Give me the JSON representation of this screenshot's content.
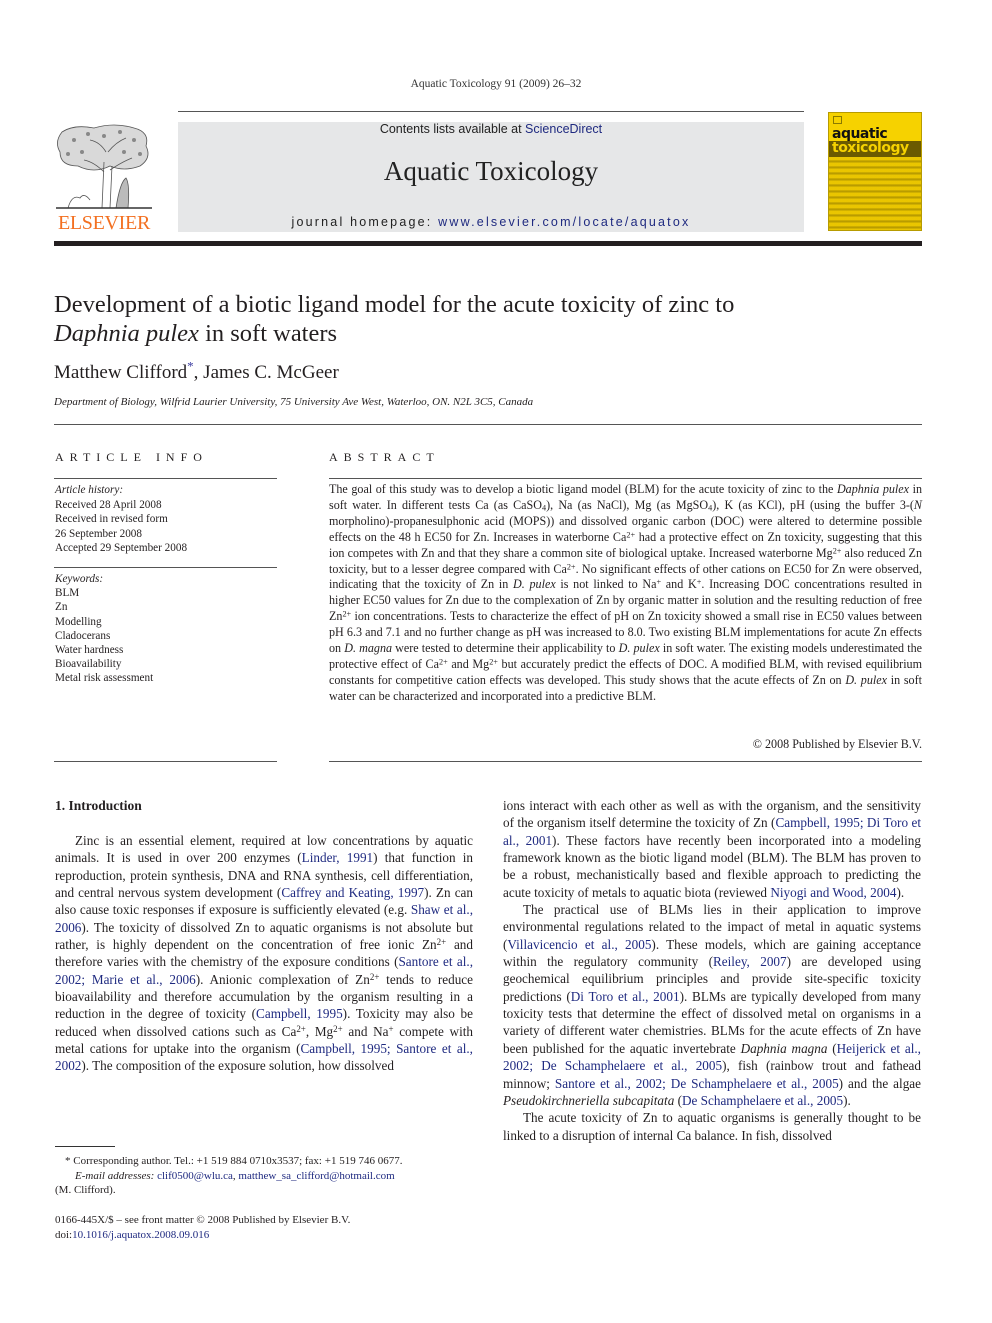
{
  "running_head": "Aquatic Toxicology 91 (2009) 26–32",
  "masthead": {
    "publisher_logo_text": "ELSEVIER",
    "contents_prefix": "Contents lists available at ",
    "contents_link": "ScienceDirect",
    "journal_title": "Aquatic Toxicology",
    "homepage_prefix": "journal homepage: ",
    "homepage_link": "www.elsevier.com/locate/aquatox",
    "cover_line1": "aquatic",
    "cover_line2": "toxicology",
    "colors": {
      "elsevier_orange": "#f37021",
      "banner_gray": "#e6e7e8",
      "cover_yellow": "#f6d200",
      "link_blue": "#1f2a80"
    }
  },
  "article": {
    "title_part1": "Development of a biotic ligand model for the acute toxicity of zinc to ",
    "title_italic": "Daphnia pulex",
    "title_part2": " in soft waters",
    "author1": "Matthew Clifford",
    "author1_mark": "*",
    "author_sep": ", ",
    "author2": "James C. McGeer",
    "affiliation": "Department of Biology, Wilfrid Laurier University, 75 University Ave West, Waterloo, ON. N2L 3C5, Canada"
  },
  "article_info": {
    "heading": "ARTICLE INFO",
    "history_label": "Article history:",
    "history": [
      "Received 28 April 2008",
      "Received in revised form",
      "26 September 2008",
      "Accepted 29 September 2008"
    ],
    "keywords_label": "Keywords:",
    "keywords": [
      "BLM",
      "Zn",
      "Modelling",
      "Cladocerans",
      "Water hardness",
      "Bioavailability",
      "Metal risk assessment"
    ]
  },
  "abstract": {
    "heading": "ABSTRACT",
    "s1": "The goal of this study was to develop a biotic ligand model (BLM) for the acute toxicity of zinc to the ",
    "s1_it": "Daphnia pulex",
    "s2": " in soft water. In different tests Ca (as CaSO",
    "s2_sub": "4",
    "s3": "), Na (as NaCl), Mg (as MgSO",
    "s3_sub": "4",
    "s4": "), K (as KCl), pH (using the buffer 3-(",
    "s4_it": "N",
    "s5": " morpholino)-propanesulphonic acid (MOPS)) and dissolved organic carbon (DOC) were altered to determine possible effects on the 48 h EC50 for Zn. Increases in waterborne Ca",
    "sup_2plus": "2+",
    "s6": " had a protective effect on Zn toxicity, suggesting that this ion competes with Zn and that they share a common site of biological uptake. Increased waterborne Mg",
    "s7": " also reduced Zn toxicity, but to a lesser degree compared with Ca",
    "s8": ". No significant effects of other cations on EC50 for Zn were observed, indicating that the toxicity of Zn in ",
    "s8_it": "D. pulex",
    "s9": " is not linked to Na",
    "sup_plus": "+",
    "s10": " and K",
    "s11": ". Increasing DOC concentrations resulted in higher EC50 values for Zn due to the complexation of Zn by organic matter in solution and the resulting reduction of free Zn",
    "s12": " ion concentrations. Tests to characterize the effect of pH on Zn toxicity showed a small rise in EC50 values between pH 6.3 and 7.1 and no further change as pH was increased to 8.0. Two existing BLM implementations for acute Zn effects on ",
    "s12_it": "D. magna",
    "s13": " were tested to determine their applicability to ",
    "s13_it": "D. pulex",
    "s14": " in soft water. The existing models underestimated the protective effect of Ca",
    "s15": " and Mg",
    "s16": " but accurately predict the effects of DOC. A modified BLM, with revised equilibrium constants for competitive cation effects was developed. This study shows that the acute effects of Zn on ",
    "s16_it": "D. pulex",
    "s17": " in soft water can be characterized and incorporated into a predictive BLM.",
    "copyright": "© 2008 Published by Elsevier B.V."
  },
  "introduction": {
    "heading": "1.  Introduction",
    "p1": {
      "t1": "Zinc is an essential element, required at low concentrations by aquatic animals. It is used in over 200 enzymes (",
      "c1": "Linder, 1991",
      "t2": ") that function in reproduction, protein synthesis, DNA and RNA synthesis, cell differentiation, and central nervous system development (",
      "c2": "Caffrey and Keating, 1997",
      "t3": "). Zn can also cause toxic responses if exposure is sufficiently elevated (e.g. ",
      "c3": "Shaw et al., 2006",
      "t4": "). The toxicity of dissolved Zn to aquatic organisms is not absolute but rather, is highly dependent on the concentration of free ionic Zn",
      "t5": " and therefore varies with the chemistry of the exposure conditions (",
      "c4": "Santore et al., 2002; Marie et al., 2006",
      "t6": "). Anionic complexation of Zn",
      "t7": " tends to reduce bioavailability and therefore accumulation by the organism resulting in a reduction in the degree of toxicity (",
      "c5": "Campbell, 1995",
      "t8": "). Toxicity may also be reduced when dissolved cations such as Ca",
      "t9": ", Mg",
      "t10": " and Na",
      "t11": " compete with metal cations for uptake into the organism (",
      "c6": "Campbell, 1995; Santore et al., 2002",
      "t12": "). The composition of the exposure solution, how dissolved ions interact with each other as well as with the organism, and the sensitivity of the organism itself determine the toxicity of Zn (",
      "c7": "Campbell, 1995; Di Toro et al., 2001",
      "t13": "). These factors have recently been incorporated into a modeling framework known as the biotic ligand model (BLM). The BLM has proven to be a robust, mechanistically based and flexible approach to predicting the acute toxicity of metals to aquatic biota (reviewed ",
      "c8": "Niyogi and Wood, 2004",
      "t14": ")."
    },
    "p2": {
      "t1": "The practical use of BLMs lies in their application to improve environmental regulations related to the impact of metal in aquatic systems (",
      "c1": "Villavicencio et al., 2005",
      "t2": "). These models, which are gaining acceptance within the regulatory community (",
      "c2": "Reiley, 2007",
      "t3": ") are developed using geochemical equilibrium principles and provide site-specific toxicity predictions (",
      "c3": "Di Toro et al., 2001",
      "t4": "). BLMs are typically developed from many toxicity tests that determine the effect of dissolved metal on organisms in a variety of different water chemistries. BLMs for the acute effects of Zn have been published for the aquatic invertebrate ",
      "i1": "Daphnia magna",
      "t5": " (",
      "c4": "Heijerick et al., 2002; De Schamphelaere et al., 2005",
      "t6": "), fish (rainbow trout and fathead minnow; ",
      "c5": "Santore et al., 2002; De Schamphelaere et al., 2005",
      "t7": ") and the algae ",
      "i2": "Pseudokirchneriella subcapitata",
      "t8": " (",
      "c6": "De Schamphelaere et al., 2005",
      "t9": ")."
    },
    "p3": {
      "t1": "The acute toxicity of Zn to aquatic organisms is generally thought to be linked to a disruption of internal Ca balance. In fish, dissolved"
    }
  },
  "footnotes": {
    "mark": "*",
    "corresponding": " Corresponding author. Tel.: +1 519 884 0710x3537; fax: +1 519 746 0677.",
    "email_label": "E-mail addresses:",
    "email1": "clif0500@wlu.ca",
    "email_sep": ", ",
    "email2": "matthew_sa_clifford@hotmail.com",
    "email_owner": "(M. Clifford).",
    "front_matter": "0166-445X/$ – see front matter © 2008 Published by Elsevier B.V.",
    "doi_label": "doi:",
    "doi": "10.1016/j.aquatox.2008.09.016"
  }
}
